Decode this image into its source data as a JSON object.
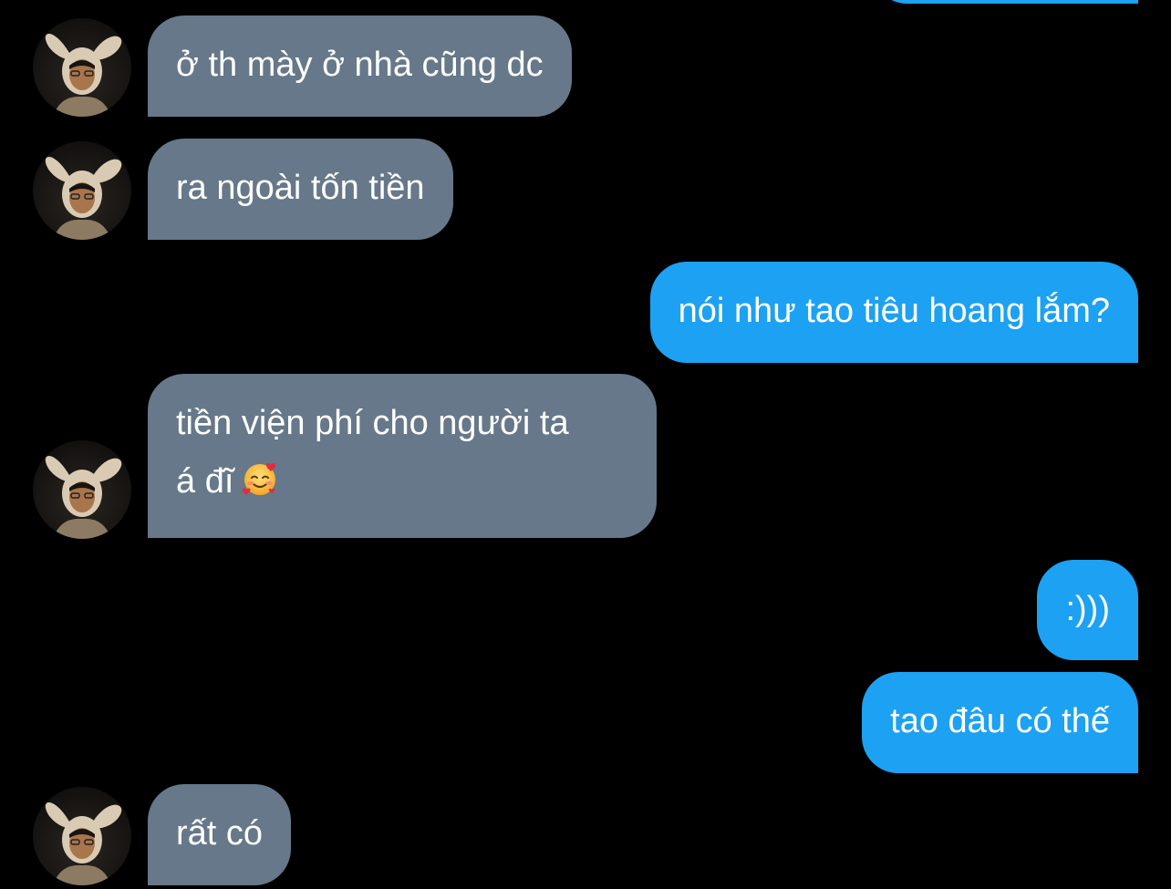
{
  "conversation": {
    "messages": [
      {
        "from": "contact",
        "lines": [
          "ở th mày ở nhà cũng dc"
        ]
      },
      {
        "from": "contact",
        "lines": [
          "ra ngoài tốn tiền"
        ]
      },
      {
        "from": "me",
        "lines": [
          "nói như tao tiêu hoang lắm?"
        ]
      },
      {
        "from": "contact",
        "lines": [
          "tiền viện phí cho người ta",
          "á đĩ"
        ],
        "emoji": "smiling-face-with-hearts-icon"
      },
      {
        "from": "me",
        "lines": [
          ":)))"
        ]
      },
      {
        "from": "me",
        "lines": [
          "tao đâu có thế"
        ]
      },
      {
        "from": "contact",
        "lines": [
          "rất có"
        ]
      }
    ]
  },
  "colors": {
    "background": "#000000",
    "incoming_bubble": "#66788a",
    "outgoing_bubble": "#1da1f2",
    "text": "#ffffff"
  }
}
